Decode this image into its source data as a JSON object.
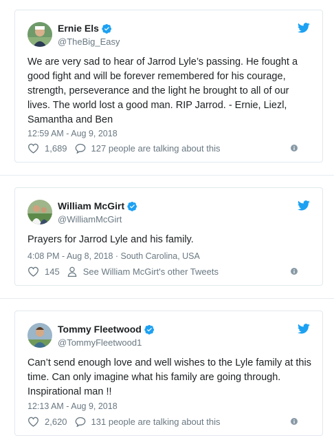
{
  "tweets": [
    {
      "name": "Ernie Els",
      "handle": "@TheBig_Easy",
      "text": "We are very sad to hear of Jarrod Lyle’s passing. He fought a good fight and will be forever remembered for his courage, strength, perseverance and the light he brought to all of our lives. The world lost a good man. RIP Jarrod. - Ernie, Liezl, Samantha and Ben",
      "meta": "12:59 AM - Aug 9, 2018",
      "likes": "1,689",
      "second_action": "127 people are talking about this",
      "second_icon": "reply-bubble-icon"
    },
    {
      "name": "William McGirt",
      "handle": "@WilliamMcGirt",
      "text": "Prayers for Jarrod Lyle and his family.",
      "meta": "4:08 PM - Aug 8, 2018 · South Carolina, USA",
      "likes": "145",
      "second_action": "See William McGirt's other Tweets",
      "second_icon": "person-icon"
    },
    {
      "name": "Tommy Fleetwood",
      "handle": "@TommyFleetwood1",
      "text": "Can’t send enough love and well wishes to the Lyle family at this time. Can only imagine what his family are going through. Inspirational man !!",
      "meta": "12:13 AM - Aug 9, 2018",
      "likes": "2,620",
      "second_action": "131 people are talking about this",
      "second_icon": "reply-bubble-icon"
    }
  ],
  "colors": {
    "twitter_blue": "#1da1f2",
    "muted": "#697882",
    "border": "#e1e8ed"
  }
}
